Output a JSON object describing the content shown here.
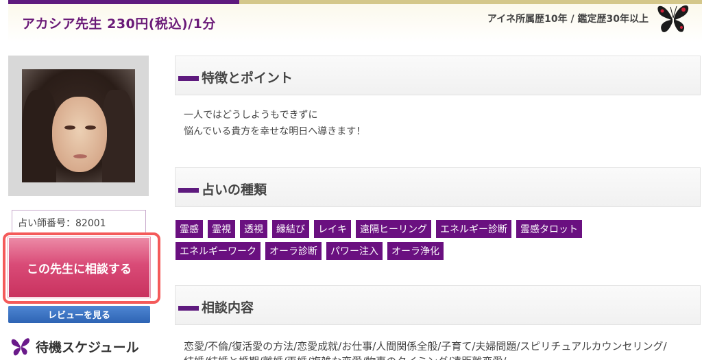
{
  "header": {
    "title": "アカシア先生 230円(税込)/1分",
    "career": "アイネ所属歴10年 / 鑑定歴30年以上"
  },
  "sidebar": {
    "fortune_id": "占い師番号：82001",
    "consult_button": "この先生に相談する",
    "review_button": "レビューを見る",
    "schedule_title": "待機スケジュール"
  },
  "sections": {
    "features_title": "特徴とポイント",
    "features_lines": [
      "一人ではどうしようもできずに",
      "悩んでいる貴方を幸せな明日へ導きます！"
    ],
    "types_title": "占いの種類",
    "types_tags": [
      "霊感",
      "霊視",
      "透視",
      "縁結び",
      "レイキ",
      "遠隔ヒーリング",
      "エネルギー診断",
      "霊感タロット",
      "エネルギーワーク",
      "オーラ診断",
      "パワー注入",
      "オーラ浄化"
    ],
    "consult_title": "相談内容",
    "consult_text": "恋愛/不倫/復活愛の方法/恋愛成就/お仕事/人間関係全般/子育て/夫婦問題/スピリチュアルカウンセリング/",
    "consult_text2": "結婚/結婚と婚期/離婚/再婚/複雑な恋愛/物事のタイミング/遠距離恋愛/"
  },
  "colors": {
    "brand_purple": "#5e1a7e",
    "tag_purple": "#6a1080",
    "consult_pink": "#d94b77",
    "review_blue": "#2e64b4",
    "highlight_red": "#f45a5a"
  },
  "icons": [
    "butterfly-icon"
  ]
}
